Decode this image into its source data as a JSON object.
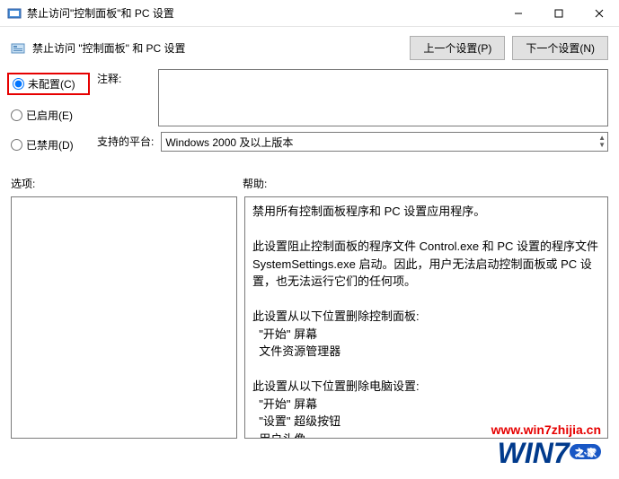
{
  "titlebar": {
    "title": "禁止访问\"控制面板\"和 PC 设置"
  },
  "header": {
    "title": "禁止访问 \"控制面板\" 和 PC 设置",
    "prev_button": "上一个设置(P)",
    "next_button": "下一个设置(N)"
  },
  "radio": {
    "not_configured": "未配置(C)",
    "enabled": "已启用(E)",
    "disabled": "已禁用(D)",
    "selected": "not_configured"
  },
  "fields": {
    "comment_label": "注释:",
    "comment_value": "",
    "platform_label": "支持的平台:",
    "platform_value": "Windows 2000 及以上版本"
  },
  "lower": {
    "options_label": "选项:",
    "help_label": "帮助:"
  },
  "help_text": "禁用所有控制面板程序和 PC 设置应用程序。\n\n此设置阻止控制面板的程序文件 Control.exe 和 PC 设置的程序文件 SystemSettings.exe 启动。因此，用户无法启动控制面板或 PC 设置，也无法运行它们的任何项。\n\n此设置从以下位置删除控制面板:\n  \"开始\" 屏幕\n  文件资源管理器\n\n此设置从以下位置删除电脑设置:\n  \"开始\" 屏幕\n  \"设置\" 超级按钮\n  用户头像\n  搜索结果",
  "watermark": {
    "url": "www.win7zhijia.cn",
    "logo_prefix": "WIN",
    "logo_num": "7",
    "logo_suffix": "之·家"
  }
}
